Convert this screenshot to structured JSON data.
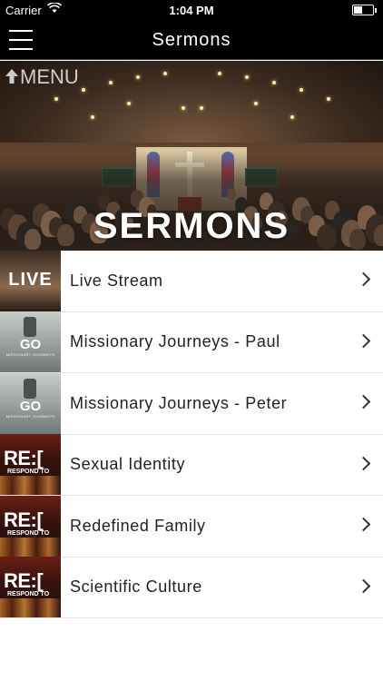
{
  "status_bar": {
    "carrier": "Carrier",
    "time": "1:04 PM",
    "battery_level": 0.45,
    "wifi_icon": "wifi-icon",
    "battery_icon": "battery-icon"
  },
  "nav_bar": {
    "menu_icon": "hamburger-menu-icon",
    "title": "Sermons"
  },
  "banner": {
    "menu_back_icon": "arrow-up-icon",
    "menu_label": "MENU",
    "title": "SERMONS"
  },
  "sermons": [
    {
      "label": "Live Stream",
      "thumb_type": "live",
      "thumb_text": "LIVE",
      "chevron_icon": "chevron-right-icon"
    },
    {
      "label": "Missionary Journeys - Paul",
      "thumb_type": "go",
      "thumb_text": "GO",
      "thumb_subtitle": "MISSIONARY JOURNEYS",
      "chevron_icon": "chevron-right-icon"
    },
    {
      "label": "Missionary Journeys - Peter",
      "thumb_type": "go",
      "thumb_text": "GO",
      "thumb_subtitle": "MISSIONARY JOURNEYS",
      "chevron_icon": "chevron-right-icon"
    },
    {
      "label": "Sexual Identity",
      "thumb_type": "re",
      "thumb_text": "RE:[",
      "thumb_subtitle": "RESPOND TO",
      "chevron_icon": "chevron-right-icon"
    },
    {
      "label": "Redefined Family",
      "thumb_type": "re",
      "thumb_text": "RE:[",
      "thumb_subtitle": "RESPOND TO",
      "chevron_icon": "chevron-right-icon"
    },
    {
      "label": "Scientific Culture",
      "thumb_type": "re",
      "thumb_text": "RE:[",
      "thumb_subtitle": "RESPOND TO",
      "chevron_icon": "chevron-right-icon"
    }
  ],
  "colors": {
    "nav_bg": "#000000",
    "nav_text": "#ffffff",
    "list_bg": "#ffffff",
    "row_text": "#222222",
    "divider": "#e3e3e3"
  }
}
